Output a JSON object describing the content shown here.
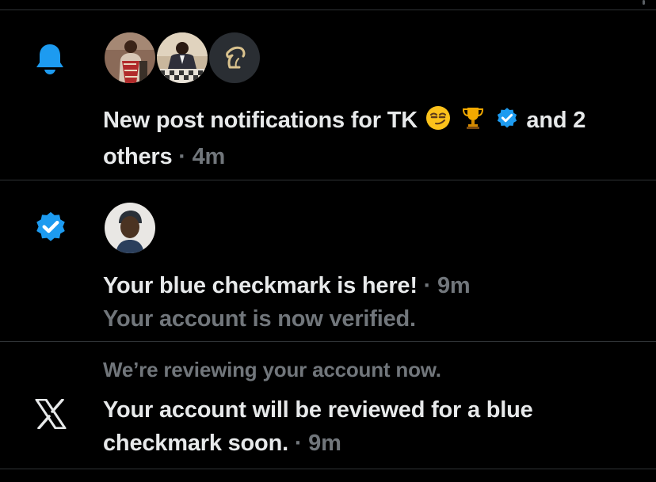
{
  "colors": {
    "background": "#000000",
    "accent_blue": "#1d9bf0",
    "primary_text": "#e7e9ea",
    "secondary_text": "#71767b",
    "divider": "#2f3336"
  },
  "notifications": [
    {
      "type_icon": "bell-icon",
      "avatars": [
        "avatar-person-portrait",
        "avatar-person-chess",
        "avatar-horse-logo"
      ],
      "title": "New post notifications for TK",
      "title_emojis": [
        "smirk-emoji",
        "trophy-emoji",
        "verified-badge-icon"
      ],
      "title_suffix": "and 2 others",
      "separator": "·",
      "time": "4m"
    },
    {
      "type_icon": "verified-badge-icon",
      "avatars": [
        "avatar-user-hat"
      ],
      "title": "Your blue checkmark is here!",
      "separator": "·",
      "time": "9m",
      "subtitle": "Your account is now verified."
    },
    {
      "type_icon": "x-logo-icon",
      "preface": "We’re reviewing your account now.",
      "title": "Your account will be reviewed for a blue checkmark soon.",
      "separator": "·",
      "time": "9m"
    }
  ]
}
